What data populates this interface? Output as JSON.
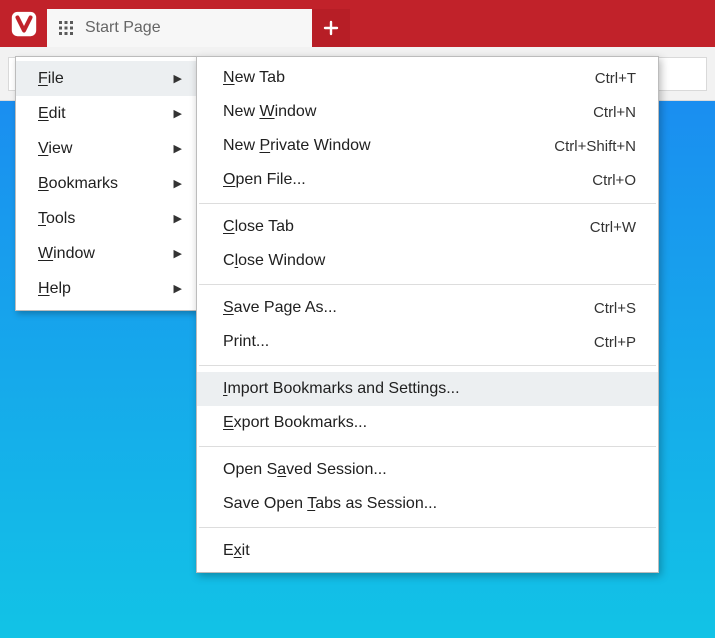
{
  "titlebar": {
    "logo": "vivaldi-logo",
    "tab_title": "Start Page",
    "newtab_icon": "plus-icon"
  },
  "mainmenu": {
    "items": [
      {
        "label": "File",
        "accel": "F",
        "has_sub": true,
        "hover": true
      },
      {
        "label": "Edit",
        "accel": "E",
        "has_sub": true,
        "hover": false
      },
      {
        "label": "View",
        "accel": "V",
        "has_sub": true,
        "hover": false
      },
      {
        "label": "Bookmarks",
        "accel": "B",
        "has_sub": true,
        "hover": false
      },
      {
        "label": "Tools",
        "accel": "T",
        "has_sub": true,
        "hover": false
      },
      {
        "label": "Window",
        "accel": "W",
        "has_sub": true,
        "hover": false
      },
      {
        "label": "Help",
        "accel": "H",
        "has_sub": true,
        "hover": false
      }
    ]
  },
  "submenu": {
    "groups": [
      [
        {
          "label": "New Tab",
          "accel": "N",
          "shortcut": "Ctrl+T"
        },
        {
          "label": "New Window",
          "accel": "W",
          "shortcut": "Ctrl+N"
        },
        {
          "label": "New Private Window",
          "accel": "P",
          "shortcut": "Ctrl+Shift+N"
        },
        {
          "label": "Open File...",
          "accel": "O",
          "shortcut": "Ctrl+O"
        }
      ],
      [
        {
          "label": "Close Tab",
          "accel": "C",
          "shortcut": "Ctrl+W"
        },
        {
          "label": "Close Window",
          "accel": "l",
          "shortcut": ""
        }
      ],
      [
        {
          "label": "Save Page As...",
          "accel": "S",
          "shortcut": "Ctrl+S"
        },
        {
          "label": "Print...",
          "accel": "",
          "shortcut": "Ctrl+P"
        }
      ],
      [
        {
          "label": "Import Bookmarks and Settings...",
          "accel": "I",
          "shortcut": "",
          "hover": true
        },
        {
          "label": "Export Bookmarks...",
          "accel": "E",
          "shortcut": ""
        }
      ],
      [
        {
          "label": "Open Saved Session...",
          "accel": "a",
          "shortcut": ""
        },
        {
          "label": "Save Open Tabs as Session...",
          "accel": "T",
          "shortcut": ""
        }
      ],
      [
        {
          "label": "Exit",
          "accel": "x",
          "shortcut": ""
        }
      ]
    ]
  }
}
